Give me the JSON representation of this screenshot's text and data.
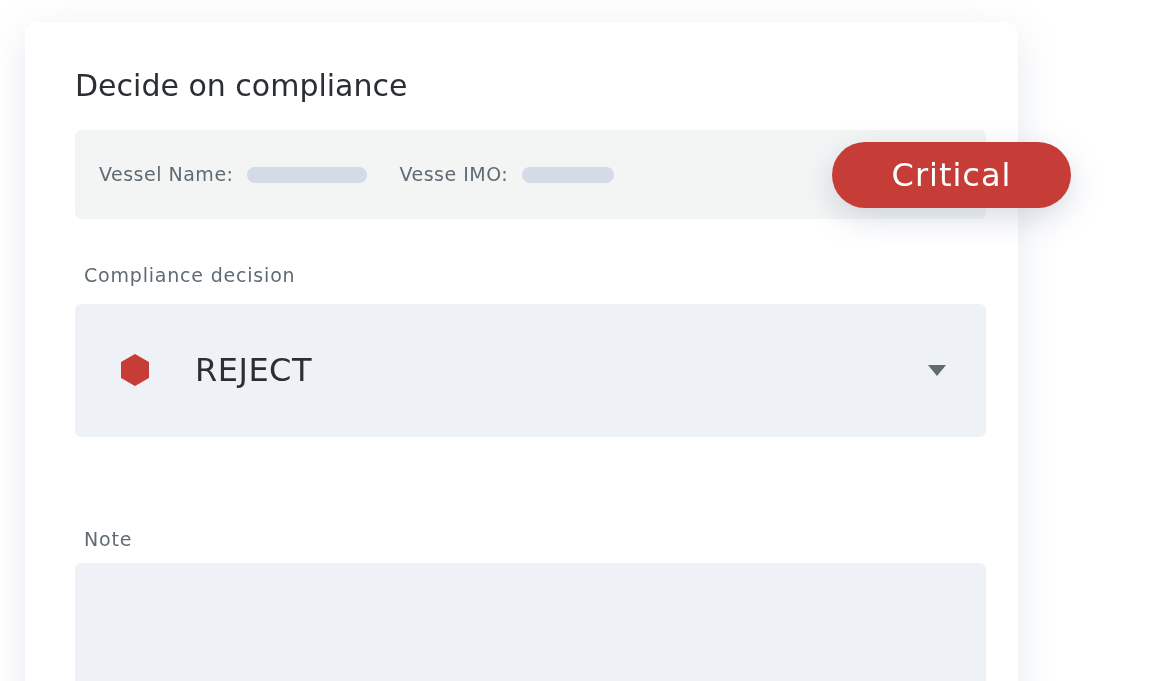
{
  "title": "Decide on compliance",
  "vessel_fields": [
    {
      "label": "Vessel Name:"
    },
    {
      "label": "Vesse IMO:"
    }
  ],
  "badge": {
    "label": "Critical"
  },
  "decision": {
    "label": "Compliance decision",
    "value": "REJECT"
  },
  "note": {
    "label": "Note"
  }
}
